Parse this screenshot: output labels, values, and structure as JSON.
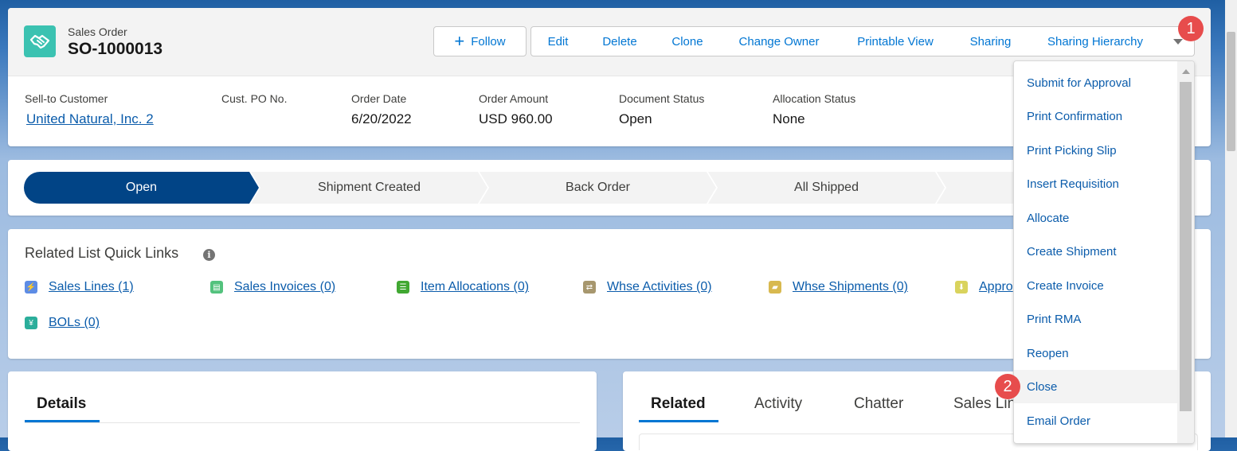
{
  "header": {
    "object_type": "Sales Order",
    "record_name": "SO-1000013",
    "follow_label": "Follow",
    "actions": [
      "Edit",
      "Delete",
      "Clone",
      "Change Owner",
      "Printable View",
      "Sharing",
      "Sharing Hierarchy"
    ],
    "fields": [
      {
        "label": "Sell-to Customer",
        "value": "United Natural, Inc. 2"
      },
      {
        "label": "Cust. PO No.",
        "value": ""
      },
      {
        "label": "Order Date",
        "value": "6/20/2022"
      },
      {
        "label": "Order Amount",
        "value": "USD 960.00"
      },
      {
        "label": "Document Status",
        "value": "Open"
      },
      {
        "label": "Allocation Status",
        "value": "None"
      }
    ]
  },
  "path": {
    "stages": [
      "Open",
      "Shipment Created",
      "Back Order",
      "All Shipped"
    ],
    "active_index": 0,
    "active_color": "#014486"
  },
  "quick_links": {
    "title": "Related List Quick Links",
    "items": [
      {
        "label": "Sales Lines (1)",
        "icon": "lightning-icon",
        "color": "#5d8ce5"
      },
      {
        "label": "Sales Invoices (0)",
        "icon": "invoice-icon",
        "color": "#53c27d"
      },
      {
        "label": "Item Allocations (0)",
        "icon": "allocation-icon",
        "color": "#41a832"
      },
      {
        "label": "Whse Activities (0)",
        "icon": "activities-icon",
        "color": "#a7976e"
      },
      {
        "label": "Whse Shipments (0)",
        "icon": "truck-icon",
        "color": "#d8b94f"
      },
      {
        "label": "Appro",
        "icon": "approval-icon",
        "color": "#d9d35d"
      },
      {
        "label": "BOLs (0)",
        "icon": "bol-icon",
        "color": "#2bae9b"
      }
    ]
  },
  "details": {
    "tab": "Details"
  },
  "related": {
    "tabs": [
      "Related",
      "Activity",
      "Chatter",
      "Sales Lin"
    ]
  },
  "menu": {
    "items": [
      "Submit for Approval",
      "Print Confirmation",
      "Print Picking Slip",
      "Insert Requisition",
      "Allocate",
      "Create Shipment",
      "Create Invoice",
      "Print RMA",
      "Reopen",
      "Close",
      "Email Order"
    ],
    "hover_index": 9
  },
  "badges": [
    "1",
    "2"
  ]
}
